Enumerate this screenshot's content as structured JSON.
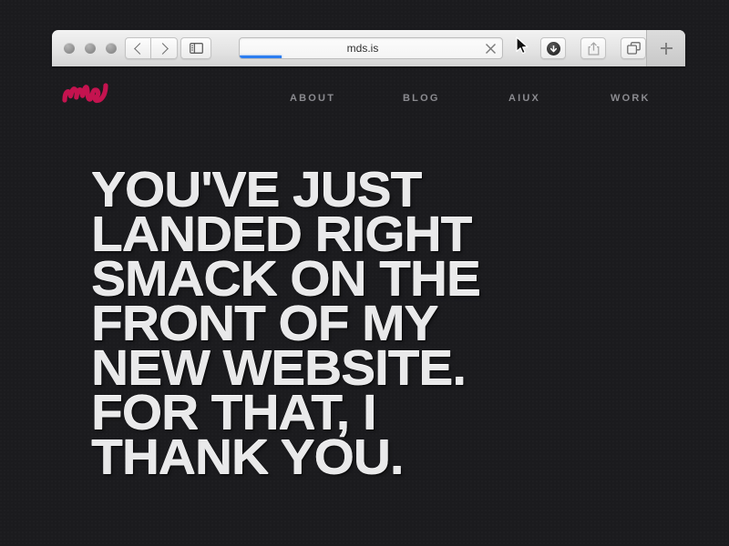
{
  "browser": {
    "url": "mds.is",
    "progress_percent": 16,
    "traffic_lights": [
      "close",
      "minimize",
      "zoom"
    ],
    "buttons": {
      "back": "back-icon",
      "forward": "forward-icon",
      "sidebar": "sidebar-toggle-icon",
      "stop": "stop-loading-icon",
      "download": "download-icon",
      "share": "share-icon",
      "tabs": "tab-overview-icon",
      "new_tab": "+"
    },
    "cursor": "arrow-pointer"
  },
  "site": {
    "logo_text": "mds",
    "logo_color": "#c4134f",
    "background_color": "#1b1b1e",
    "nav": [
      {
        "label": "ABOUT"
      },
      {
        "label": "BLOG"
      },
      {
        "label": "AIUX"
      },
      {
        "label": "WORK"
      }
    ],
    "headline": "YOU'VE JUST\nLANDED RIGHT\nSMACK ON THE\nFRONT OF MY\nNEW WEBSITE.\nFOR THAT, I\nTHANK YOU.",
    "headline_color": "#e9e9ea"
  }
}
